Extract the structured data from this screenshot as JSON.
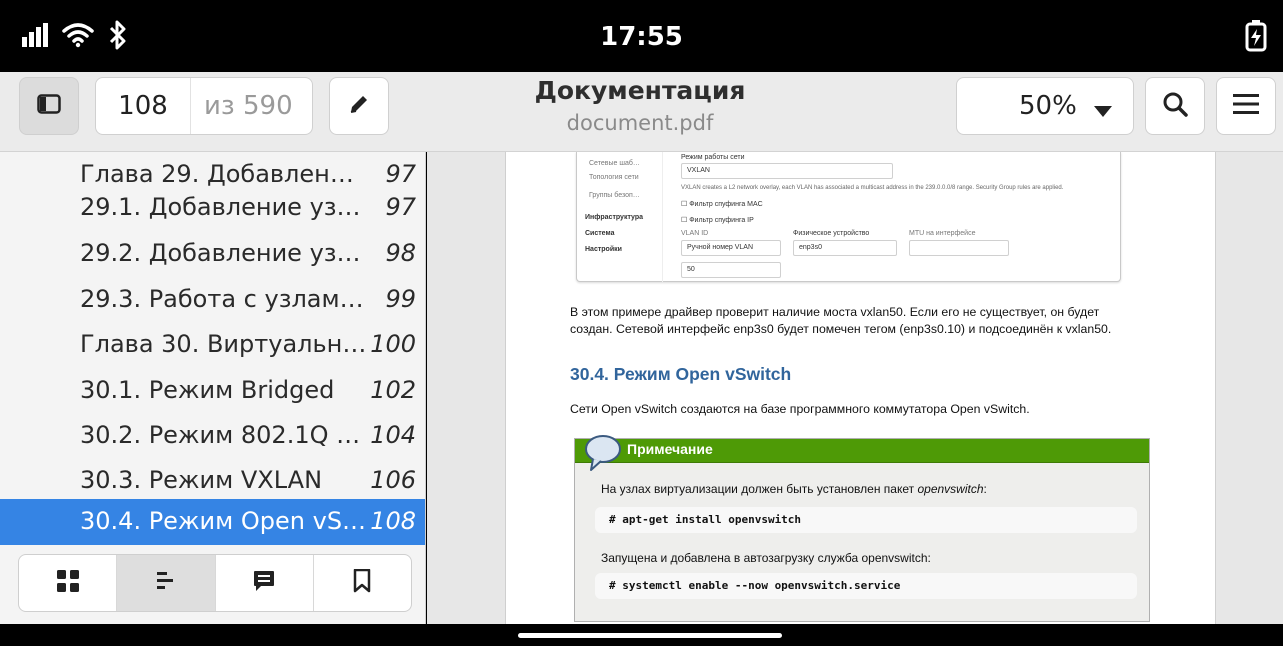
{
  "status_bar": {
    "time": "17:55",
    "icons": [
      "signal-icon",
      "wifi-icon",
      "bluetooth-icon",
      "battery-charging-icon"
    ]
  },
  "header": {
    "page_current": "108",
    "page_total": "из 590",
    "title": "Документация",
    "filename": "document.pdf",
    "zoom": "50%",
    "icons": [
      "sidebar-toggle-icon",
      "pencil-icon",
      "chevron-down-icon",
      "search-icon",
      "hamburger-menu-icon"
    ]
  },
  "sidebar": {
    "toc": [
      {
        "label": "Глава 29. Добавлен…",
        "page": "97"
      },
      {
        "label": "29.1. Добавление уз…",
        "page": "97"
      },
      {
        "label": "29.2. Добавление уз…",
        "page": "98"
      },
      {
        "label": "29.3. Работа с узлам…",
        "page": "99"
      },
      {
        "label": "Глава 30. Виртуальн…",
        "page": "100"
      },
      {
        "label": "30.1. Режим Bridged",
        "page": "102"
      },
      {
        "label": "30.2. Режим 802.1Q …",
        "page": "104"
      },
      {
        "label": "30.3. Режим VXLAN",
        "page": "106"
      },
      {
        "label": "30.4. Режим Open vS…",
        "page": "108"
      }
    ],
    "selected_index": 8,
    "tabs": [
      "thumbnails-grid-icon",
      "outline-icon",
      "annotations-icon",
      "bookmarks-icon"
    ],
    "active_tab": 1
  },
  "document": {
    "screenshot": {
      "nav": [
        "Сетевые шаб…",
        "Топология сети",
        "Группы безоп…",
        "Инфраструктура",
        "Система",
        "Настройки"
      ],
      "mode_label": "Режим работы сети",
      "mode_value": "VXLAN",
      "mode_desc": "VXLAN creates a L2 network overlay, each VLAN has associated a multicast address in the 239.0.0.0/8 range. Security Group rules are applied.",
      "checkbox_mac": "Фильтр спуфинга MAC",
      "checkbox_ip": "Фильтр спуфинга IP",
      "vlan_label": "VLAN ID",
      "vlan_select": "Ручной номер VLAN",
      "vlan_value": "50",
      "phys_label": "Физическое устройство",
      "phys_value": "enp3s0",
      "mtu_label": "MTU на интерфейсе"
    },
    "para1_line1": "В этом примере драйвер проверит наличие моста vxlan50. Если его не существует, он будет",
    "para1_line2": "создан. Сетевой интерфейс enp3s0 будет помечен тегом (enp3s0.10) и подсоединён к vxlan50.",
    "section_title": "30.4. Режим Open vSwitch",
    "para2": "Сети Open vSwitch создаются на базе программного коммутатора Open vSwitch.",
    "note": {
      "title": "Примечание",
      "text1": "На узлах виртуализации должен быть установлен пакет ",
      "text1_em": "openvswitch",
      "text1_end": ":",
      "code1": "# apt-get install openvswitch",
      "text2": "Запущена и добавлена в автозагрузку служба openvswitch:",
      "code2": "# systemctl enable --now openvswitch.service"
    }
  }
}
